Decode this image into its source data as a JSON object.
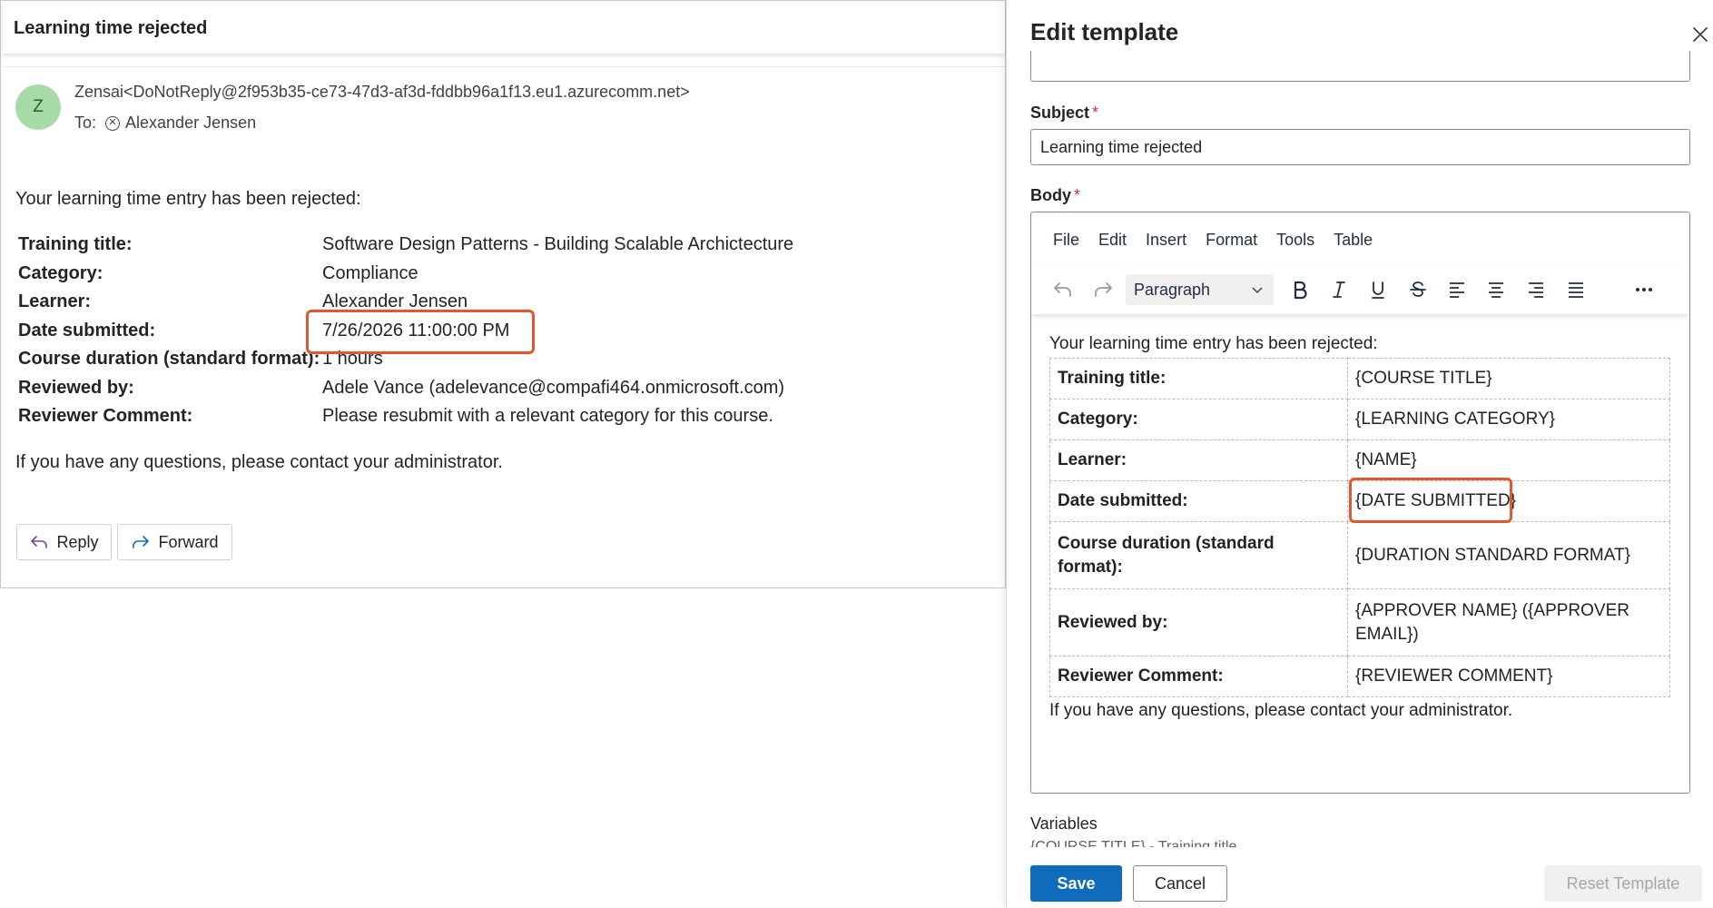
{
  "email": {
    "subject": "Learning time rejected",
    "avatar_initial": "Z",
    "sender": "Zensai<DoNotReply@2f953b35-ce73-47d3-af3d-fddbb96a1f13.eu1.azurecomm.net>",
    "to_label": "To:",
    "to_name": "Alexander Jensen",
    "intro": "Your learning time entry has been rejected:",
    "details": [
      {
        "label": "Training title:",
        "value": "Software Design Patterns - Building Scalable Archictecture"
      },
      {
        "label": "Category:",
        "value": "Compliance"
      },
      {
        "label": "Learner:",
        "value": "Alexander Jensen"
      },
      {
        "label": "Date submitted:",
        "value": "7/26/2026 11:00:00 PM"
      },
      {
        "label": "Course duration (standard format):",
        "value": "1 hours"
      },
      {
        "label": "Reviewed by:",
        "value": "Adele Vance (adelevance@compafi464.onmicrosoft.com)"
      },
      {
        "label": "Reviewer Comment:",
        "value": "Please resubmit with a relevant category for this course."
      }
    ],
    "closing": "If you have any questions, please contact your administrator.",
    "reply_label": "Reply",
    "forward_label": "Forward"
  },
  "panel": {
    "title": "Edit template",
    "subject_label": "Subject",
    "required_mark": "*",
    "subject_value": "Learning time rejected",
    "body_label": "Body",
    "menu": [
      "File",
      "Edit",
      "Insert",
      "Format",
      "Tools",
      "Table"
    ],
    "block_format": "Paragraph",
    "editor": {
      "intro": "Your learning time entry has been rejected:",
      "rows": [
        {
          "label": "Training title:",
          "value": "{COURSE TITLE}"
        },
        {
          "label": "Category:",
          "value": "{LEARNING CATEGORY}"
        },
        {
          "label": "Learner:",
          "value": "{NAME}"
        },
        {
          "label": "Date submitted:",
          "value": "{DATE SUBMITTED}"
        },
        {
          "label": "Course duration (standard format):",
          "value": "{DURATION STANDARD FORMAT}"
        },
        {
          "label": "Reviewed by:",
          "value": "{APPROVER NAME} ({APPROVER EMAIL})"
        },
        {
          "label": "Reviewer Comment:",
          "value": "{REVIEWER COMMENT}"
        }
      ],
      "closing": "If you have any questions, please contact your administrator."
    },
    "variables_label": "Variables",
    "variables_peek": "{COURSE TITLE} - Training title",
    "save_label": "Save",
    "cancel_label": "Cancel",
    "reset_label": "Reset Template"
  },
  "colors": {
    "accent": "#0f6cbd",
    "highlight": "#e0582b",
    "avatar_bg": "#a6dba8",
    "required": "#c4314b"
  }
}
